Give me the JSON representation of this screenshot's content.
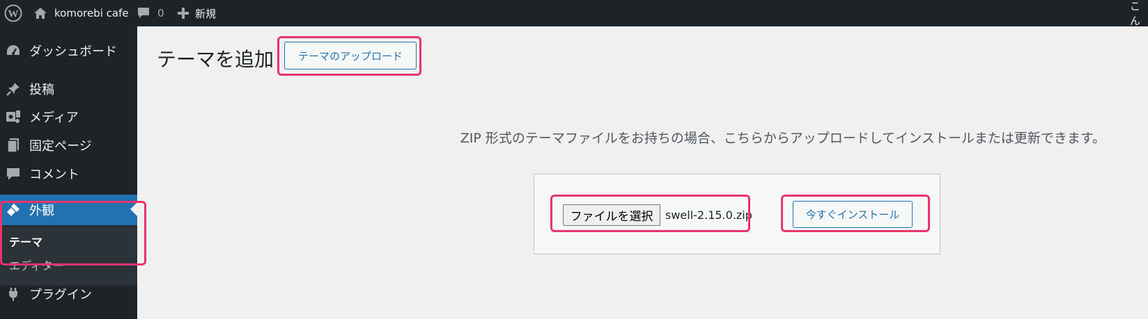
{
  "adminbar": {
    "wp_logo_icon": "wordpress-logo-icon",
    "site_name": "komorebi cafe",
    "comments_count": "0",
    "new_label": "新規",
    "right_text": "こん"
  },
  "sidebar": {
    "items": [
      {
        "label": "ダッシュボード",
        "icon": "dashboard-icon"
      },
      {
        "label": "投稿",
        "icon": "pushpin-icon"
      },
      {
        "label": "メディア",
        "icon": "media-icon"
      },
      {
        "label": "固定ページ",
        "icon": "page-icon"
      },
      {
        "label": "コメント",
        "icon": "comment-icon"
      },
      {
        "label": "外観",
        "icon": "paintbrush-icon"
      },
      {
        "label": "プラグイン",
        "icon": "plugin-icon"
      }
    ],
    "submenu": [
      {
        "label": "テーマ"
      },
      {
        "label": "エディター"
      }
    ]
  },
  "main": {
    "title": "テーマを追加",
    "upload_toggle_label": "テーマのアップロード",
    "description": "ZIP 形式のテーマファイルをお持ちの場合、こちらからアップロードしてインストールまたは更新できます。",
    "file_button_label": "ファイルを選択",
    "file_name": "swell-2.15.0.zip",
    "install_button_label": "今すぐインストール"
  },
  "colors": {
    "adminbar_bg": "#1d2327",
    "accent": "#2271b1",
    "highlight": "#e8336d",
    "page_bg": "#f0f0f1"
  }
}
